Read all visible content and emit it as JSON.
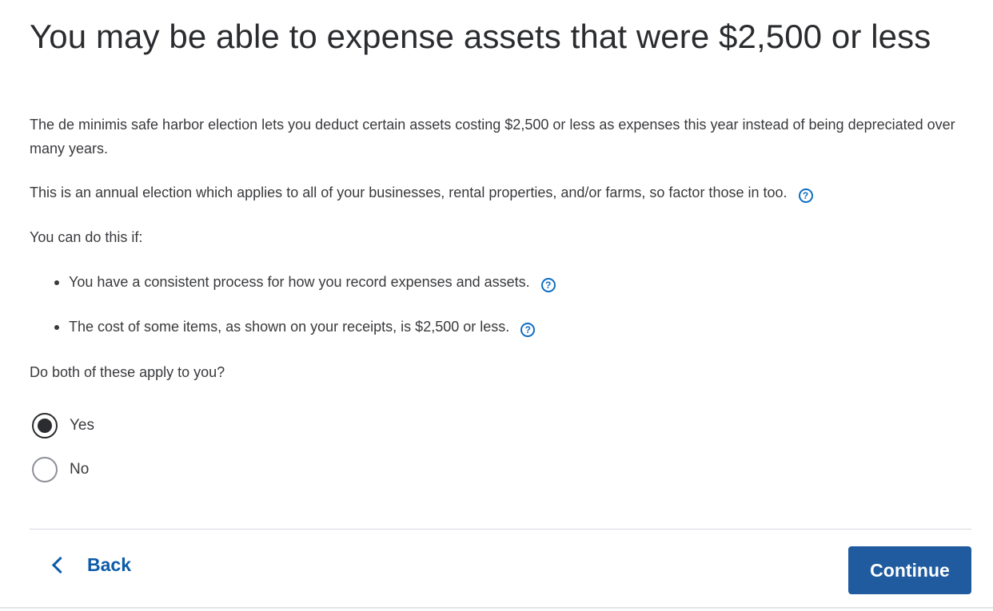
{
  "title": "You may be able to expense assets that were $2,500 or less",
  "intro": "The de minimis safe harbor election lets you deduct certain assets costing $2,500 or less as expenses this year instead of being depreciated over many years.",
  "annual_note": "This is an annual election which applies to all of your businesses, rental properties, and/or farms, so factor those in too.",
  "conditions_lead": "You can do this if:",
  "conditions": [
    "You have a consistent process for how you record expenses and assets.",
    "The cost of some items, as shown on your receipts, is $2,500 or less."
  ],
  "help_glyph": "?",
  "question": "Do both of these apply to you?",
  "options": {
    "yes": {
      "label": "Yes",
      "selected": true
    },
    "no": {
      "label": "No",
      "selected": false
    }
  },
  "nav": {
    "back_label": "Back",
    "continue_label": "Continue"
  },
  "colors": {
    "accent": "#0d6ec2",
    "link": "#0d5ba8",
    "primary_button": "#1f5b9e",
    "text": "#393a3d"
  }
}
